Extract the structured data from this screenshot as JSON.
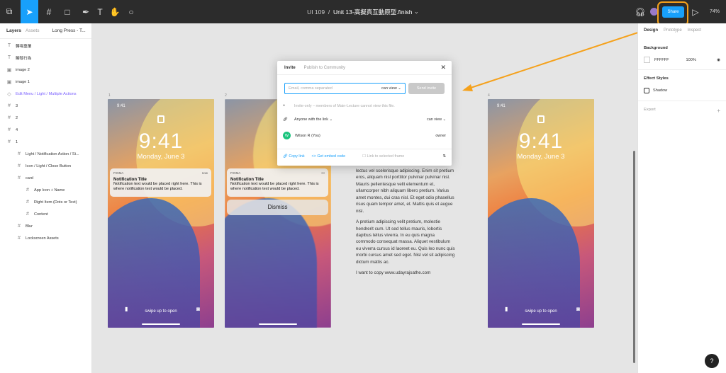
{
  "toolbar": {
    "file_prefix": "UI 109",
    "separator": "/",
    "file_name": "Unit 13-高擬真互動原型.finish",
    "share_label": "Share",
    "zoom": "74%"
  },
  "left_panel": {
    "tab_layers": "Layers",
    "tab_assets": "Assets",
    "page": "Long Press - T...",
    "layers": [
      {
        "icon": "T",
        "label": "轉場重覆"
      },
      {
        "icon": "T",
        "label": "觸發行為"
      },
      {
        "icon": "▣",
        "label": "image 2"
      },
      {
        "icon": "▣",
        "label": "image 1"
      },
      {
        "icon": "◇",
        "label": "Edit Menu / Light / Multiple Actions"
      },
      {
        "icon": "#",
        "label": "3"
      },
      {
        "icon": "#",
        "label": "2"
      },
      {
        "icon": "#",
        "label": "4"
      },
      {
        "icon": "#",
        "label": "1"
      },
      {
        "icon": "#",
        "label": "Light / Notification Action / Si..."
      },
      {
        "icon": "#",
        "label": "Icon / Light / Close Button"
      },
      {
        "icon": "#",
        "label": "card"
      },
      {
        "icon": "#",
        "label": "App Icon + Name"
      },
      {
        "icon": "#",
        "label": "Right Item (Dots or Text)"
      },
      {
        "icon": "#",
        "label": "Content"
      },
      {
        "icon": "#",
        "label": "Blur"
      },
      {
        "icon": "#",
        "label": "Lockscreen Assets"
      }
    ]
  },
  "right_panel": {
    "tab_design": "Design",
    "tab_prototype": "Prototype",
    "tab_inspect": "Inspect",
    "background_title": "Background",
    "bg_hex": "FFFFFF",
    "bg_opacity": "100%",
    "effects_title": "Effect Styles",
    "effect": "Shadow",
    "export_title": "Export"
  },
  "frames": [
    {
      "number": "1",
      "time": "9:41",
      "date": "Monday, June 3",
      "app": "FIGMA",
      "when": "now",
      "title": "Notification Title",
      "body": "Notification text would be placed right here. This is where notification text would be placed.",
      "swipe": "swipe up to open"
    },
    {
      "number": "2",
      "app": "FIGMA",
      "title": "Notification Title",
      "body": "Notification text would be placed right here. This is where notification text would be placed.",
      "dismiss": "Dismiss"
    },
    {
      "number": "4",
      "time": "9:41",
      "date": "Monday, June 3",
      "swipe": "swipe up to open"
    }
  ],
  "text_block": {
    "p1": "lectus vel scelerisque adipiscing. Enim sit pretium eros, aliquam nisl porttitor pulvinar pulvinar nisl. Mauris pellentesque velit elementum et, ullamcorper nibh aliquam libero pretium. Varius amet montes, dui cras nisl. Et eget odio phasellus risus quam tempor amet, et. Mattis quis et augue nisl.",
    "p2": "A pretium adipiscing velit pretium, molestie hendrerit cum. Ut sed tellus mauris, lobortis dapibus tellus viverra. In eu quis magna commodo consequat massa. Aliquet vestibulum eu viverra cursus id laoreet eu. Quis leo nunc quis morbi cursus amet sed eget. Nisl vel sit adipiscing dictum mattis ac.",
    "p3": "I want to copy www.udayrajsathe.com"
  },
  "modal": {
    "tab_invite": "Invite",
    "tab_publish": "Publish to Community",
    "email_placeholder": "Email, comma separated",
    "permission": "can view",
    "send_label": "Send invite",
    "invite_only": "Invite-only – members of Main-Lecture cannot view this file.",
    "link_access": "Anyone with the link",
    "link_permission": "can view",
    "user_initial": "W",
    "user_name": "Wilson R (You)",
    "user_role": "owner",
    "copy_link": "Copy link",
    "embed": "Get embed code",
    "link_frame": "Link to selected frame"
  },
  "help": "?"
}
